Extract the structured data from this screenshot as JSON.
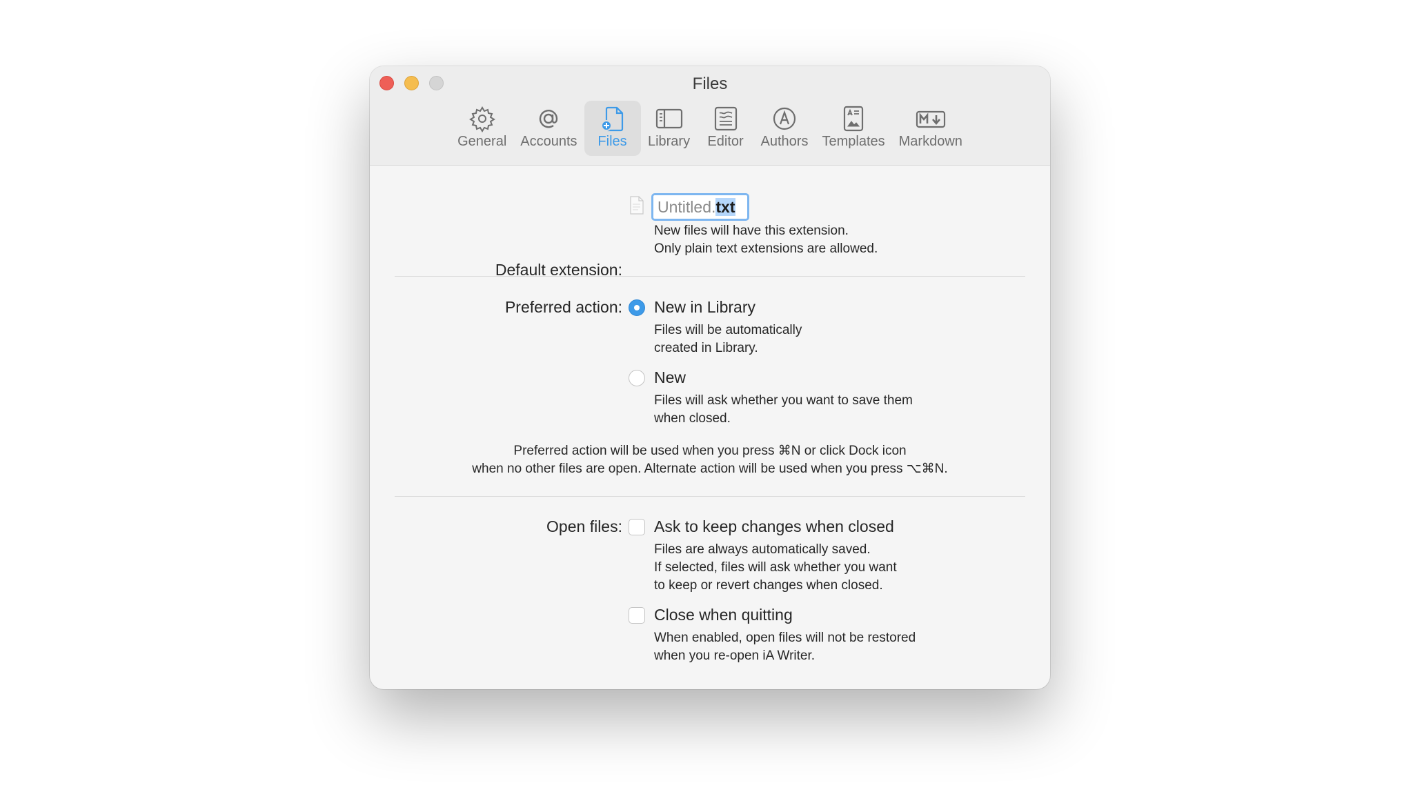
{
  "window": {
    "title": "Files"
  },
  "toolbar": {
    "tabs": [
      {
        "label": "General",
        "icon": "gear-icon"
      },
      {
        "label": "Accounts",
        "icon": "at-sign-icon"
      },
      {
        "label": "Files",
        "icon": "new-file-icon",
        "active": true
      },
      {
        "label": "Library",
        "icon": "sidebar-icon"
      },
      {
        "label": "Editor",
        "icon": "text-lines-icon"
      },
      {
        "label": "Authors",
        "icon": "author-circle-icon"
      },
      {
        "label": "Templates",
        "icon": "template-icon"
      },
      {
        "label": "Markdown",
        "icon": "markdown-icon"
      }
    ]
  },
  "default_extension": {
    "label": "Default extension:",
    "base": "Untitled.",
    "ext": "txt",
    "desc1": "New files will have this extension.",
    "desc2": "Only plain text extensions are allowed."
  },
  "preferred_action": {
    "label": "Preferred action:",
    "options": [
      {
        "label": "New in Library",
        "desc1": "Files will be automatically",
        "desc2": "created in Library.",
        "selected": true
      },
      {
        "label": "New",
        "desc1": "Files will ask whether you want to save them",
        "desc2": "when closed.",
        "selected": false
      }
    ],
    "note1": "Preferred action will be used when you press ⌘N or click Dock icon",
    "note2": "when no other files are open. Alternate action will be used when you press ⌥⌘N."
  },
  "open_files": {
    "label": "Open files:",
    "options": [
      {
        "label": "Ask to keep changes when closed",
        "desc1": "Files are always automatically saved.",
        "desc2": "If selected, files will ask whether you want",
        "desc3": "to keep or revert changes when closed.",
        "checked": false
      },
      {
        "label": "Close when quitting",
        "desc1": "When enabled, open files will not be restored",
        "desc2": "when you re-open iA Writer.",
        "checked": false
      }
    ]
  },
  "colors": {
    "accent": "#3d9ae8",
    "close": "#ee5f57",
    "minimize": "#f5bd4f",
    "zoom": "#d5d5d5"
  }
}
